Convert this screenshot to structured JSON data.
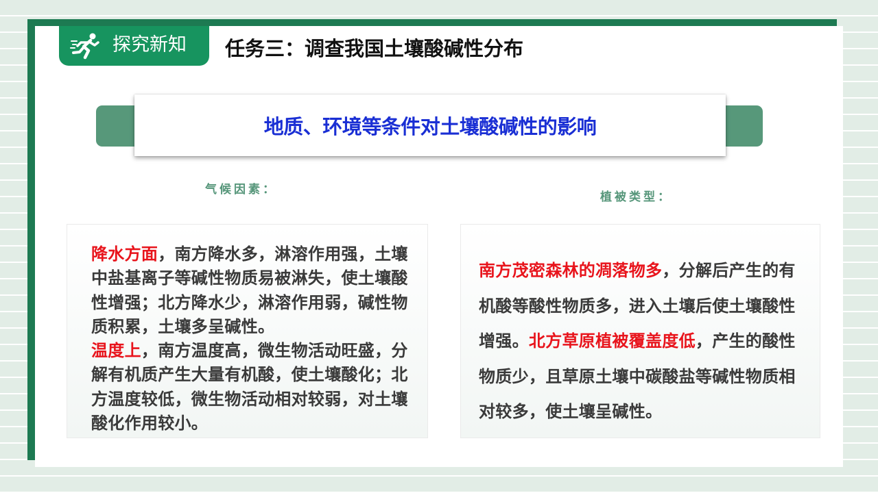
{
  "header": {
    "tag_label": "探究新知",
    "tag_icon": "running-person-icon",
    "title": "任务三：调查我国土壤酸碱性分布"
  },
  "banner": {
    "text": "地质、环境等条件对土壤酸碱性的影响"
  },
  "factors": {
    "climate_label": "气候因素：",
    "vegetation_label": "植被类型："
  },
  "climate_panel": {
    "p1_highlight": "降水方面",
    "p1_text": "，南方降水多，淋溶作用强，土壤中盐基离子等碱性物质易被淋失，使土壤酸性增强；北方降水少，淋溶作用弱，碱性物质积累，土壤多呈碱性。",
    "p2_highlight": "温度上",
    "p2_text": "，南方温度高，微生物活动旺盛，分解有机质产生大量有机酸，使土壤酸化；北方温度较低，微生物活动相对较弱，对土壤酸化作用较小。"
  },
  "vegetation_panel": {
    "p1_highlight": "南方茂密森林的凋落物多",
    "p1_text": "，分解后产生的有机酸等酸性物质多，进入土壤后使土壤酸性增强。",
    "p2_highlight": "北方草原植被覆盖度低",
    "p2_text": "，产生的酸性物质少，且草原土壤中碳酸盐等碱性物质相对较多，使土壤呈碱性。"
  },
  "colors": {
    "frame_green": "#1d7a52",
    "tag_green": "#17945f",
    "banner_green": "#57987a",
    "banner_text_blue": "#1a2fd4",
    "highlight_red": "#e8141c",
    "factor_label_green": "#56967a"
  }
}
